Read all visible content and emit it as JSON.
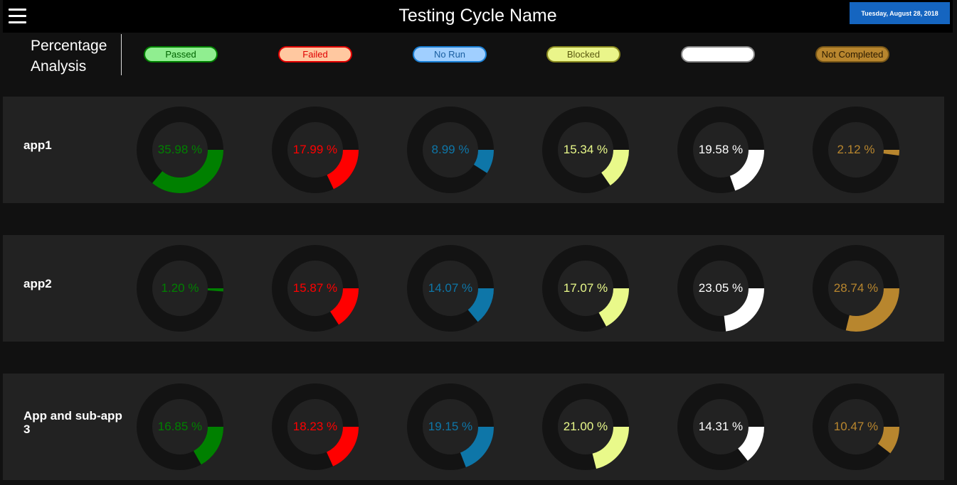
{
  "header": {
    "title": "Testing Cycle Name",
    "date": "Tuesday, August 28, 2018"
  },
  "analysis": {
    "label_line1": "Percentage",
    "label_line2": "Analysis"
  },
  "legend": [
    {
      "label": "Passed",
      "fill": "#90ee90",
      "border": "#008000",
      "text": "#006400"
    },
    {
      "label": "Failed",
      "fill": "#ffc8a0",
      "border": "#e00000",
      "text": "#e00000"
    },
    {
      "label": "No Run",
      "fill": "#a0cfff",
      "border": "#1a7fd4",
      "text": "#1a5fa0"
    },
    {
      "label": "Blocked",
      "fill": "#eaf58a",
      "border": "#8a8a20",
      "text": "#5a5a10"
    },
    {
      "label": "",
      "fill": "#ffffff",
      "border": "#888888",
      "text": "#000000"
    },
    {
      "label": "Not Completed",
      "fill": "#b8862e",
      "border": "#7a5818",
      "text": "#2a1a00"
    }
  ],
  "status_colors": [
    "#008000",
    "#ff0000",
    "#0e76a8",
    "#e9f98a",
    "#ffffff",
    "#b8862e"
  ],
  "rows": [
    {
      "name": "app1",
      "values": [
        {
          "pct": 35.98,
          "text": "35.98 %"
        },
        {
          "pct": 17.99,
          "text": "17.99 %"
        },
        {
          "pct": 8.99,
          "text": "8.99 %"
        },
        {
          "pct": 15.34,
          "text": "15.34 %"
        },
        {
          "pct": 19.58,
          "text": "19.58 %"
        },
        {
          "pct": 2.12,
          "text": "2.12 %"
        }
      ]
    },
    {
      "name": "app2",
      "values": [
        {
          "pct": 1.2,
          "text": "1.20 %"
        },
        {
          "pct": 15.87,
          "text": "15.87 %"
        },
        {
          "pct": 14.07,
          "text": "14.07 %"
        },
        {
          "pct": 17.07,
          "text": "17.07 %"
        },
        {
          "pct": 23.05,
          "text": "23.05 %"
        },
        {
          "pct": 28.74,
          "text": "28.74 %"
        }
      ]
    },
    {
      "name": "App and sub-app 3",
      "values": [
        {
          "pct": 16.85,
          "text": "16.85 %"
        },
        {
          "pct": 18.23,
          "text": "18.23 %"
        },
        {
          "pct": 19.15,
          "text": "19.15 %"
        },
        {
          "pct": 21.0,
          "text": "21.00 %"
        },
        {
          "pct": 14.31,
          "text": "14.31 %"
        },
        {
          "pct": 10.47,
          "text": "10.47 %"
        }
      ]
    }
  ]
}
